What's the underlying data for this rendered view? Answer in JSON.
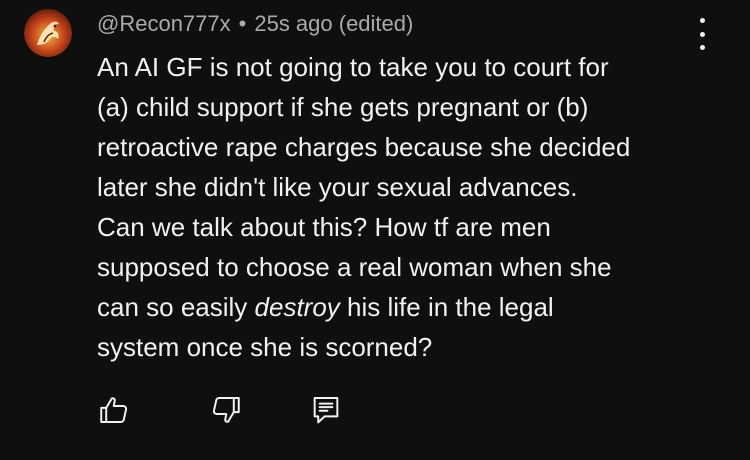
{
  "comment": {
    "author": "@Recon777x",
    "separator": "•",
    "time": "25s ago (edited)",
    "text_lines": [
      "An AI GF is not going to take you to court for",
      "(a) child support if she gets pregnant or (b)",
      "retroactive rape charges because she decided",
      "later she didn't like your sexual advances.",
      "Can we talk about this? How tf are men",
      "supposed to choose a real woman when she"
    ],
    "line7_before": "can so easily ",
    "line7_emphasis": "destroy",
    "line7_after": " his life in the legal",
    "line8": "system once she is scorned?"
  },
  "icons": {
    "avatar": "avatar-image",
    "more": "more-vertical-icon",
    "like": "thumbs-up-icon",
    "dislike": "thumbs-down-icon",
    "reply": "reply-comment-icon"
  },
  "colors": {
    "background": "#0f0f0f",
    "text_primary": "#f1f1f1",
    "text_secondary": "#aaaaaa"
  }
}
